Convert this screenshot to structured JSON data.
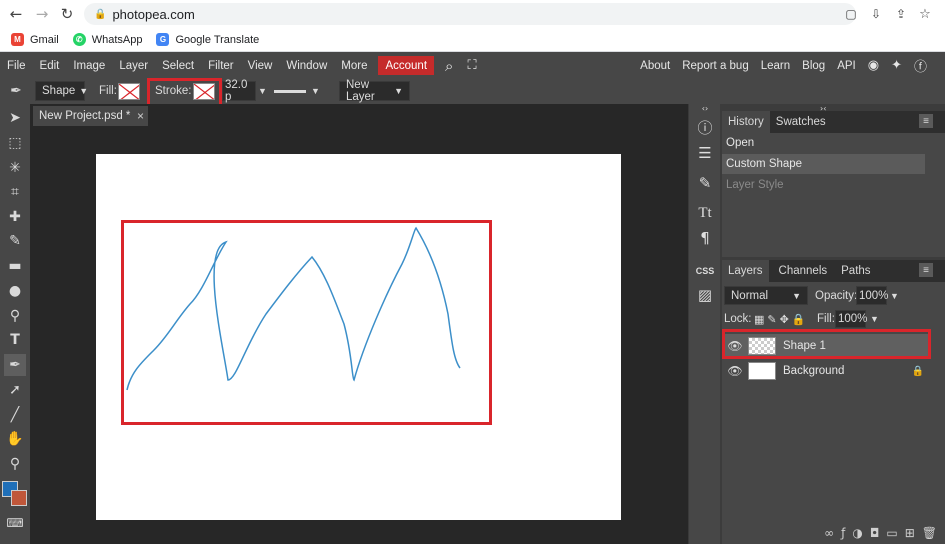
{
  "browser": {
    "url": "photopea.com",
    "bookmarks": [
      {
        "label": "Gmail",
        "icon": "gmail-icon",
        "color": "#ea4335"
      },
      {
        "label": "WhatsApp",
        "icon": "whatsapp-icon",
        "color": "#25d366"
      },
      {
        "label": "Google Translate",
        "icon": "translate-icon",
        "color": "#4285f4"
      }
    ]
  },
  "menubar": {
    "items": [
      "File",
      "Edit",
      "Image",
      "Layer",
      "Select",
      "Filter",
      "View",
      "Window",
      "More"
    ],
    "account": "Account",
    "right_items": [
      "About",
      "Report a bug",
      "Learn",
      "Blog",
      "API"
    ]
  },
  "options": {
    "shape_label": "Shape",
    "fill_label": "Fill:",
    "stroke_label": "Stroke:",
    "stroke_width": "32.0 p",
    "new_layer": "New Layer"
  },
  "document": {
    "tab_title": "New Project.psd *",
    "close": "×",
    "stroke_color": "#3c8fc9"
  },
  "history": {
    "tabs": [
      "History",
      "Swatches"
    ],
    "items": [
      {
        "label": "Open",
        "state": "normal"
      },
      {
        "label": "Custom Shape",
        "state": "selected"
      },
      {
        "label": "Layer Style",
        "state": "dimmed"
      }
    ]
  },
  "layers_panel": {
    "tabs": [
      "Layers",
      "Channels",
      "Paths"
    ],
    "blend_mode": "Normal",
    "opacity_label": "Opacity:",
    "opacity_value": "100%",
    "lock_label": "Lock:",
    "fill_label": "Fill:",
    "fill_value": "100%",
    "layers": [
      {
        "name": "Shape 1",
        "selected": true,
        "locked": false
      },
      {
        "name": "Background",
        "selected": false,
        "locked": true
      }
    ]
  },
  "colors": {
    "highlight": "#d9252b",
    "foreground": "#1f6fb8",
    "background": "#c0573a"
  }
}
